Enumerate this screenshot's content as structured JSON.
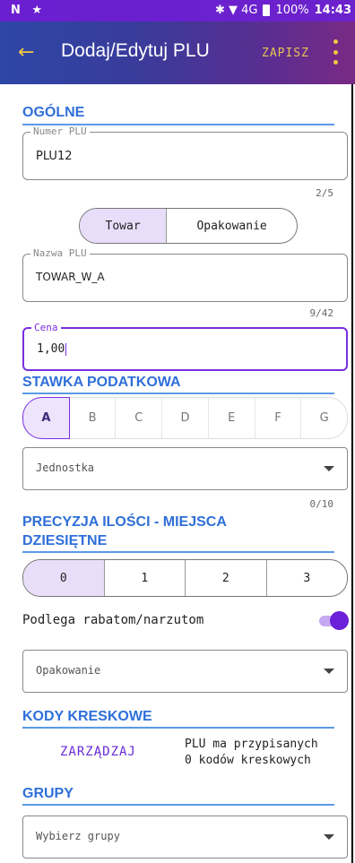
{
  "status_bar": {
    "left_icons": "N ★",
    "right_icons": "✱ ▼ 4G",
    "battery": "100%",
    "time": "14:43"
  },
  "app_bar": {
    "back_icon": "arrow-left-icon",
    "title": "Dodaj/Edytuj PLU",
    "save_label": "ZAPISZ",
    "menu_icon": "more-vertical-icon",
    "accent_color": "#f4c542"
  },
  "general": {
    "section_title": "OGÓLNE",
    "plu_number": {
      "label": "Numer PLU",
      "value": "PLU12",
      "counter": "2/5"
    },
    "type_toggle": {
      "options": [
        "Towar",
        "Opakowanie"
      ],
      "selected": "Towar"
    },
    "plu_name": {
      "label": "Nazwa PLU",
      "value": "TOWAR_W_A",
      "counter": "9/42"
    },
    "price": {
      "label": "Cena",
      "value": "1,00"
    }
  },
  "tax_rate": {
    "section_title": "STAWKA PODATKOWA",
    "options": [
      "A",
      "B",
      "C",
      "D",
      "E",
      "F",
      "G"
    ],
    "selected": "A",
    "unit_dropdown": {
      "placeholder": "Jednostka",
      "counter": "0/10"
    }
  },
  "precision": {
    "section_title_line1": "PRECYZJA ILOŚCI - MIEJSCA",
    "section_title_line2": "DZIESIĘTNE",
    "options": [
      "0",
      "1",
      "2",
      "3"
    ],
    "selected": "0"
  },
  "discounts": {
    "label": "Podlega rabatom/narzutom",
    "enabled": true
  },
  "packaging_dropdown": {
    "placeholder": "Opakowanie"
  },
  "barcodes": {
    "section_title": "KODY KRESKOWE",
    "manage_label": "ZARZĄDZAJ",
    "info_line1": "PLU ma przypisanych",
    "info_line2": "0 kodów kreskowych"
  },
  "groups": {
    "section_title": "GRUPY",
    "dropdown_placeholder": "Wybierz grupy"
  },
  "colors": {
    "section_title": "#2f6fd8",
    "accent_purple": "#7a2fe0",
    "selected_bg": "#e8defa"
  }
}
